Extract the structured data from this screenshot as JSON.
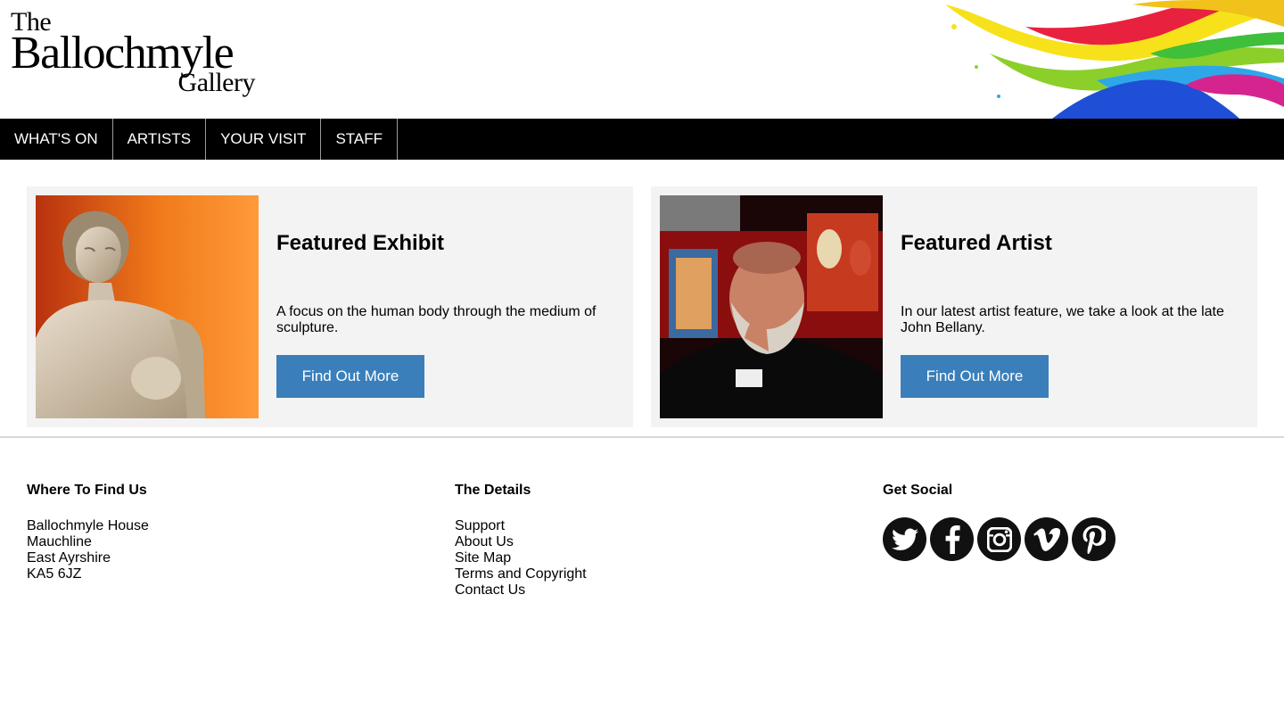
{
  "logo": {
    "line1": "The",
    "line2": "Ballochmyle",
    "line3": "Gallery"
  },
  "nav": [
    {
      "label": "WHAT'S ON"
    },
    {
      "label": "ARTISTS"
    },
    {
      "label": "YOUR VISIT"
    },
    {
      "label": "STAFF"
    }
  ],
  "features": [
    {
      "title": "Featured Exhibit",
      "description": "A focus on the human body through the medium of sculpture.",
      "button": "Find Out More"
    },
    {
      "title": "Featured Artist",
      "description": "In our latest artist feature, we take a look at the late John Bellany.",
      "button": "Find Out More"
    }
  ],
  "footer": {
    "location": {
      "heading": "Where To Find Us",
      "lines": [
        "Ballochmyle House",
        "Mauchline",
        "East Ayrshire",
        "KA5 6JZ"
      ]
    },
    "details": {
      "heading": "The Details",
      "links": [
        "Support",
        "About Us",
        "Site Map",
        "Terms and Copyright",
        "Contact Us"
      ]
    },
    "social": {
      "heading": "Get Social",
      "icons": [
        "twitter-icon",
        "facebook-icon",
        "instagram-icon",
        "vimeo-icon",
        "pinterest-icon"
      ]
    }
  },
  "colors": {
    "nav_bg": "#000000",
    "button_bg": "#3a7fba",
    "card_bg": "#f3f3f3",
    "social_bg": "#111111"
  }
}
